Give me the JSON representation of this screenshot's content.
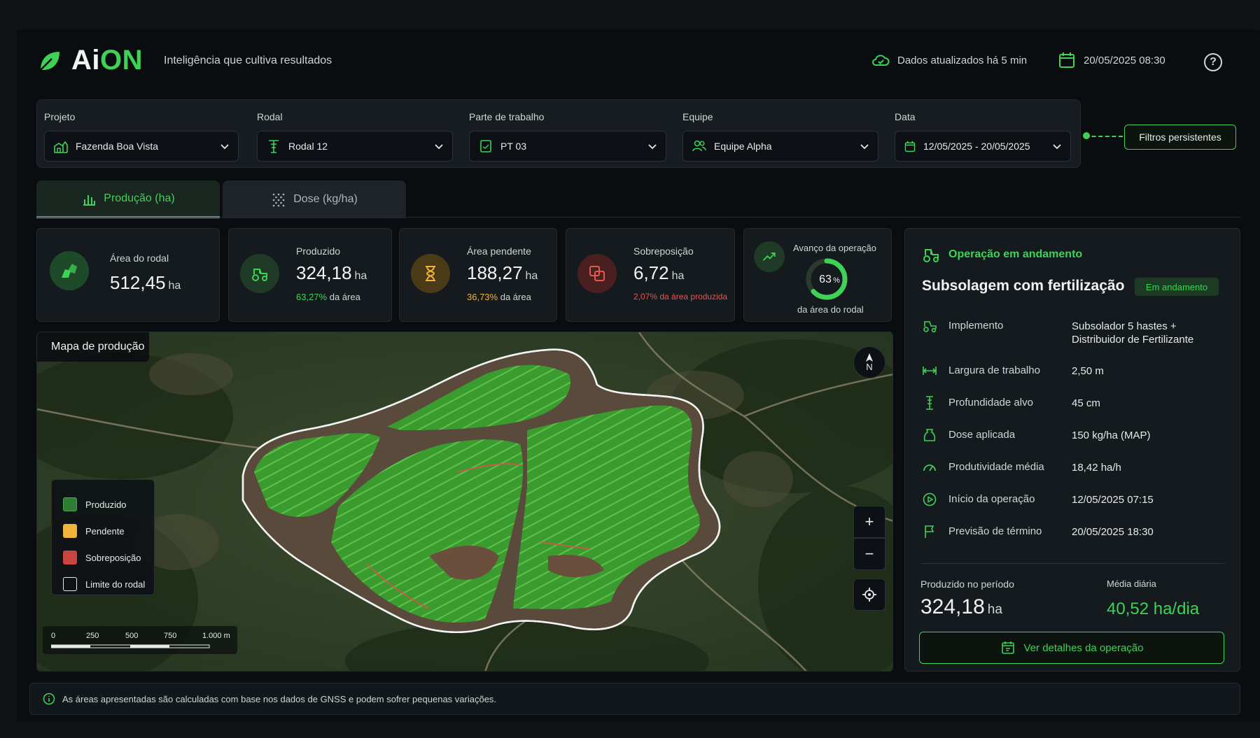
{
  "brand": {
    "name_part1": "Ai",
    "name_part2": "ON",
    "tagline": "Inteligência que cultiva resultados"
  },
  "header": {
    "update_status": "Dados atualizados há 5 min",
    "datetime": "20/05/2025 08:30",
    "help": "?"
  },
  "filters": [
    {
      "label": "Projeto",
      "value": "Fazenda Boa Vista",
      "icon": "farm-icon"
    },
    {
      "label": "Rodal",
      "value": "Rodal 12",
      "icon": "stand-icon"
    },
    {
      "label": "Parte de trabalho",
      "value": "PT 03",
      "icon": "worksheet-icon"
    },
    {
      "label": "Equipe",
      "value": "Equipe Alpha",
      "icon": "team-icon"
    },
    {
      "label": "Data",
      "value": "12/05/2025 - 20/05/2025",
      "icon": "calendar-icon"
    }
  ],
  "persist_button": "Filtros persistentes",
  "tabs": [
    {
      "label": "Produção (ha)"
    },
    {
      "label": "Dose (kg/ha)"
    }
  ],
  "kpis": {
    "area": {
      "label": "Área do rodal",
      "value": "512,45",
      "unit": "ha"
    },
    "produzido": {
      "label": "Produzido",
      "value": "324,18",
      "unit": "ha",
      "pct": "63,27%",
      "suffix": "da área"
    },
    "pendente": {
      "label": "Área pendente",
      "value": "188,27",
      "unit": "ha",
      "pct": "36,73%",
      "suffix": "da área"
    },
    "sobreposicao": {
      "label": "Sobreposição",
      "value": "6,72",
      "unit": "ha",
      "sub": "2,07% da área produzida"
    },
    "avanco": {
      "label": "Avanço da operação",
      "value": "63",
      "pct_symbol": "%",
      "progress": 0.63,
      "sub": "da área do rodal"
    }
  },
  "map": {
    "title": "Mapa de produção",
    "north": "N",
    "legend": [
      {
        "label": "Produzido",
        "color": "#2f7d32"
      },
      {
        "label": "Pendente",
        "color": "#f1b43a"
      },
      {
        "label": "Sobreposição",
        "color": "#c9453f"
      },
      {
        "label": "Limite do rodal",
        "color": "transparent"
      }
    ],
    "scale": [
      "0",
      "250",
      "500",
      "750",
      "1.000 m"
    ],
    "zoom_in": "+",
    "zoom_out": "−"
  },
  "operation": {
    "heading": "Operação em andamento",
    "title": "Subsolagem com fertilização",
    "status": "Em andamento",
    "details": [
      {
        "label": "Implemento",
        "value": "Subsolador 5 hastes + Distribuidor de Fertilizante"
      },
      {
        "label": "Largura de trabalho",
        "value": "2,50 m"
      },
      {
        "label": "Profundidade alvo",
        "value": "45 cm"
      },
      {
        "label": "Dose aplicada",
        "value": "150 kg/ha (MAP)"
      },
      {
        "label": "Produtividade média",
        "value": "18,42 ha/h"
      },
      {
        "label": "Início da operação",
        "value": "12/05/2025 07:15"
      },
      {
        "label": "Previsão de término",
        "value": "20/05/2025 18:30"
      }
    ],
    "produced_label": "Produzido no período",
    "produced_value": "324,18",
    "produced_unit": "ha",
    "daily_label": "Média diária",
    "daily_value": "40,52 ha/dia",
    "details_button": "Ver detalhes da operação"
  },
  "footer": "As áreas apresentadas são calculadas com base nos dados de GNSS e podem sofrer pequenas variações.",
  "colors": {
    "accent": "#3ed256",
    "pending": "#f1b43a",
    "overlap": "#e0584f"
  }
}
